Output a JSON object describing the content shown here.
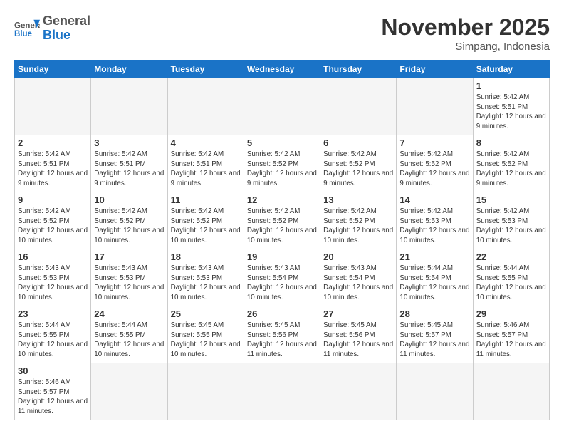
{
  "header": {
    "logo_general": "General",
    "logo_blue": "Blue",
    "month_title": "November 2025",
    "subtitle": "Simpang, Indonesia"
  },
  "days_of_week": [
    "Sunday",
    "Monday",
    "Tuesday",
    "Wednesday",
    "Thursday",
    "Friday",
    "Saturday"
  ],
  "weeks": [
    [
      {
        "day": "",
        "empty": true
      },
      {
        "day": "",
        "empty": true
      },
      {
        "day": "",
        "empty": true
      },
      {
        "day": "",
        "empty": true
      },
      {
        "day": "",
        "empty": true
      },
      {
        "day": "",
        "empty": true
      },
      {
        "day": "1",
        "info": "Sunrise: 5:42 AM\nSunset: 5:51 PM\nDaylight: 12 hours and 9 minutes."
      }
    ],
    [
      {
        "day": "2",
        "info": "Sunrise: 5:42 AM\nSunset: 5:51 PM\nDaylight: 12 hours and 9 minutes."
      },
      {
        "day": "3",
        "info": "Sunrise: 5:42 AM\nSunset: 5:51 PM\nDaylight: 12 hours and 9 minutes."
      },
      {
        "day": "4",
        "info": "Sunrise: 5:42 AM\nSunset: 5:51 PM\nDaylight: 12 hours and 9 minutes."
      },
      {
        "day": "5",
        "info": "Sunrise: 5:42 AM\nSunset: 5:52 PM\nDaylight: 12 hours and 9 minutes."
      },
      {
        "day": "6",
        "info": "Sunrise: 5:42 AM\nSunset: 5:52 PM\nDaylight: 12 hours and 9 minutes."
      },
      {
        "day": "7",
        "info": "Sunrise: 5:42 AM\nSunset: 5:52 PM\nDaylight: 12 hours and 9 minutes."
      },
      {
        "day": "8",
        "info": "Sunrise: 5:42 AM\nSunset: 5:52 PM\nDaylight: 12 hours and 9 minutes."
      }
    ],
    [
      {
        "day": "9",
        "info": "Sunrise: 5:42 AM\nSunset: 5:52 PM\nDaylight: 12 hours and 10 minutes."
      },
      {
        "day": "10",
        "info": "Sunrise: 5:42 AM\nSunset: 5:52 PM\nDaylight: 12 hours and 10 minutes."
      },
      {
        "day": "11",
        "info": "Sunrise: 5:42 AM\nSunset: 5:52 PM\nDaylight: 12 hours and 10 minutes."
      },
      {
        "day": "12",
        "info": "Sunrise: 5:42 AM\nSunset: 5:52 PM\nDaylight: 12 hours and 10 minutes."
      },
      {
        "day": "13",
        "info": "Sunrise: 5:42 AM\nSunset: 5:52 PM\nDaylight: 12 hours and 10 minutes."
      },
      {
        "day": "14",
        "info": "Sunrise: 5:42 AM\nSunset: 5:53 PM\nDaylight: 12 hours and 10 minutes."
      },
      {
        "day": "15",
        "info": "Sunrise: 5:42 AM\nSunset: 5:53 PM\nDaylight: 12 hours and 10 minutes."
      }
    ],
    [
      {
        "day": "16",
        "info": "Sunrise: 5:43 AM\nSunset: 5:53 PM\nDaylight: 12 hours and 10 minutes."
      },
      {
        "day": "17",
        "info": "Sunrise: 5:43 AM\nSunset: 5:53 PM\nDaylight: 12 hours and 10 minutes."
      },
      {
        "day": "18",
        "info": "Sunrise: 5:43 AM\nSunset: 5:53 PM\nDaylight: 12 hours and 10 minutes."
      },
      {
        "day": "19",
        "info": "Sunrise: 5:43 AM\nSunset: 5:54 PM\nDaylight: 12 hours and 10 minutes."
      },
      {
        "day": "20",
        "info": "Sunrise: 5:43 AM\nSunset: 5:54 PM\nDaylight: 12 hours and 10 minutes."
      },
      {
        "day": "21",
        "info": "Sunrise: 5:44 AM\nSunset: 5:54 PM\nDaylight: 12 hours and 10 minutes."
      },
      {
        "day": "22",
        "info": "Sunrise: 5:44 AM\nSunset: 5:55 PM\nDaylight: 12 hours and 10 minutes."
      }
    ],
    [
      {
        "day": "23",
        "info": "Sunrise: 5:44 AM\nSunset: 5:55 PM\nDaylight: 12 hours and 10 minutes."
      },
      {
        "day": "24",
        "info": "Sunrise: 5:44 AM\nSunset: 5:55 PM\nDaylight: 12 hours and 10 minutes."
      },
      {
        "day": "25",
        "info": "Sunrise: 5:45 AM\nSunset: 5:55 PM\nDaylight: 12 hours and 10 minutes."
      },
      {
        "day": "26",
        "info": "Sunrise: 5:45 AM\nSunset: 5:56 PM\nDaylight: 12 hours and 11 minutes."
      },
      {
        "day": "27",
        "info": "Sunrise: 5:45 AM\nSunset: 5:56 PM\nDaylight: 12 hours and 11 minutes."
      },
      {
        "day": "28",
        "info": "Sunrise: 5:45 AM\nSunset: 5:57 PM\nDaylight: 12 hours and 11 minutes."
      },
      {
        "day": "29",
        "info": "Sunrise: 5:46 AM\nSunset: 5:57 PM\nDaylight: 12 hours and 11 minutes."
      }
    ],
    [
      {
        "day": "30",
        "info": "Sunrise: 5:46 AM\nSunset: 5:57 PM\nDaylight: 12 hours and 11 minutes."
      },
      {
        "day": "",
        "empty": true
      },
      {
        "day": "",
        "empty": true
      },
      {
        "day": "",
        "empty": true
      },
      {
        "day": "",
        "empty": true
      },
      {
        "day": "",
        "empty": true
      },
      {
        "day": "",
        "empty": true
      }
    ]
  ]
}
